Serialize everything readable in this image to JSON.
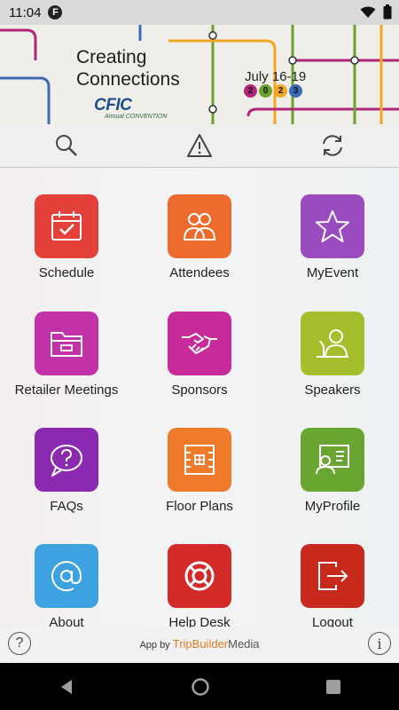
{
  "status": {
    "time": "11:04",
    "app_badge": "F"
  },
  "banner": {
    "title_line1": "Creating",
    "title_line2": "Connections",
    "brand": "CFIC",
    "brand_sub": "Annual CONVENTION",
    "date": "July 16-19",
    "year_digits": [
      "2",
      "0",
      "2",
      "3"
    ],
    "year_colors": [
      "#b0277a",
      "#6aa02f",
      "#f2a623",
      "#3b6bb5"
    ]
  },
  "toolbar": {
    "search": "search-icon",
    "alert": "warning-icon",
    "sync": "sync-icon"
  },
  "tiles": [
    {
      "label": "Schedule",
      "color": "#e4413a",
      "icon": "calendar-check-icon"
    },
    {
      "label": "Attendees",
      "color": "#ef6a2d",
      "icon": "people-icon"
    },
    {
      "label": "MyEvent",
      "color": "#9a4bc0",
      "icon": "star-icon"
    },
    {
      "label": "Retailer Meetings",
      "color": "#c231a8",
      "icon": "folder-icon"
    },
    {
      "label": "Sponsors",
      "color": "#c92a9a",
      "icon": "handshake-icon"
    },
    {
      "label": "Speakers",
      "color": "#a5be2b",
      "icon": "speaker-podium-icon"
    },
    {
      "label": "FAQs",
      "color": "#8b2ab0",
      "icon": "question-bubble-icon"
    },
    {
      "label": "Floor Plans",
      "color": "#ef7a2a",
      "icon": "floor-plan-icon"
    },
    {
      "label": "MyProfile",
      "color": "#69a531",
      "icon": "profile-card-icon"
    },
    {
      "label": "About",
      "color": "#3da3e0",
      "icon": "at-icon"
    },
    {
      "label": "Help Desk",
      "color": "#d42a2a",
      "icon": "lifebuoy-icon"
    },
    {
      "label": "Logout",
      "color": "#c72a1c",
      "icon": "logout-icon"
    }
  ],
  "footer": {
    "help": "?",
    "credit_prefix": "App by",
    "credit_brand1": "TripBuilder",
    "credit_brand2": "Media",
    "info": "i"
  }
}
